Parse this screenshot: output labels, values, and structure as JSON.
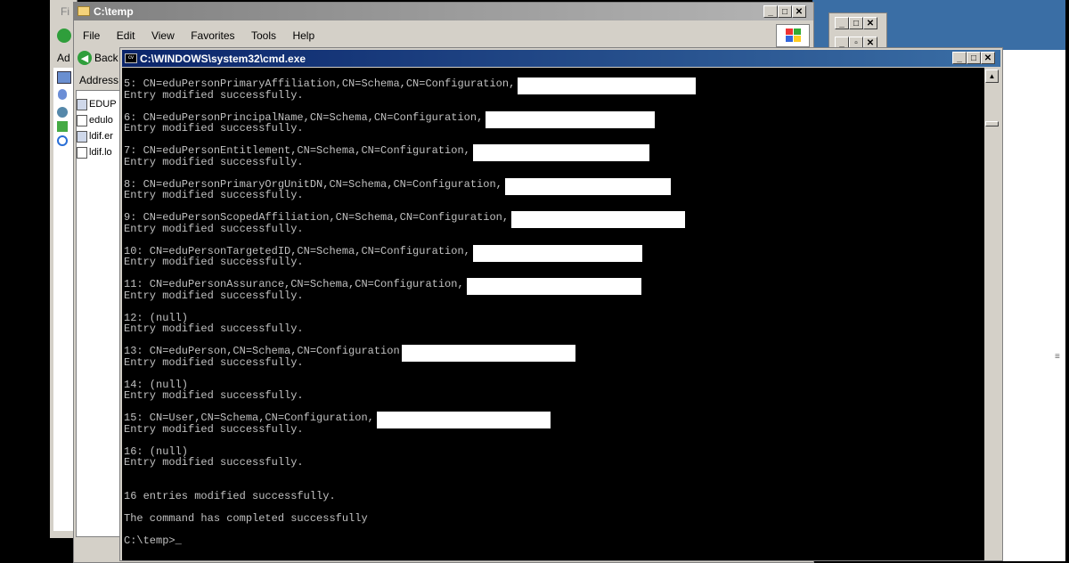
{
  "explorer_back": {
    "menu_fragment": "Fi",
    "addr_fragment": "Ad"
  },
  "explorer": {
    "title": "C:\\temp",
    "menu": [
      "File",
      "Edit",
      "View",
      "Favorites",
      "Tools",
      "Help"
    ],
    "back_label": "Back",
    "address_label": "Address",
    "files": [
      "EDUP",
      "edulo",
      "ldif.er",
      "ldif.lo"
    ]
  },
  "cmd": {
    "title": "C:\\WINDOWS\\system32\\cmd.exe",
    "lines": [
      {
        "text": "5: CN=eduPersonPrimaryAffiliation,CN=Schema,CN=Configuration,",
        "redact_w": 200
      },
      {
        "text": "Entry modified successfully."
      },
      {
        "text": ""
      },
      {
        "text": "6: CN=eduPersonPrincipalName,CN=Schema,CN=Configuration,",
        "redact_w": 190
      },
      {
        "text": "Entry modified successfully."
      },
      {
        "text": ""
      },
      {
        "text": "7: CN=eduPersonEntitlement,CN=Schema,CN=Configuration,",
        "redact_w": 198
      },
      {
        "text": "Entry modified successfully."
      },
      {
        "text": ""
      },
      {
        "text": "8: CN=eduPersonPrimaryOrgUnitDN,CN=Schema,CN=Configuration,",
        "redact_w": 186
      },
      {
        "text": "Entry modified successfully."
      },
      {
        "text": ""
      },
      {
        "text": "9: CN=eduPersonScopedAffiliation,CN=Schema,CN=Configuration,",
        "redact_w": 195
      },
      {
        "text": "Entry modified successfully."
      },
      {
        "text": ""
      },
      {
        "text": "10: CN=eduPersonTargetedID,CN=Schema,CN=Configuration,",
        "redact_w": 190
      },
      {
        "text": "Entry modified successfully."
      },
      {
        "text": ""
      },
      {
        "text": "11: CN=eduPersonAssurance,CN=Schema,CN=Configuration,",
        "redact_w": 196
      },
      {
        "text": "Entry modified successfully."
      },
      {
        "text": ""
      },
      {
        "text": "12: (null)"
      },
      {
        "text": "Entry modified successfully."
      },
      {
        "text": ""
      },
      {
        "text": "13: CN=eduPerson,CN=Schema,CN=Configuration",
        "redact_w": 195
      },
      {
        "text": "Entry modified successfully."
      },
      {
        "text": ""
      },
      {
        "text": "14: (null)"
      },
      {
        "text": "Entry modified successfully."
      },
      {
        "text": ""
      },
      {
        "text": "15: CN=User,CN=Schema,CN=Configuration,",
        "redact_w": 195
      },
      {
        "text": "Entry modified successfully."
      },
      {
        "text": ""
      },
      {
        "text": "16: (null)"
      },
      {
        "text": "Entry modified successfully."
      },
      {
        "text": ""
      },
      {
        "text": ""
      },
      {
        "text": "16 entries modified successfully."
      },
      {
        "text": ""
      },
      {
        "text": "The command has completed successfully"
      },
      {
        "text": ""
      },
      {
        "text": "C:\\temp>_"
      }
    ]
  }
}
